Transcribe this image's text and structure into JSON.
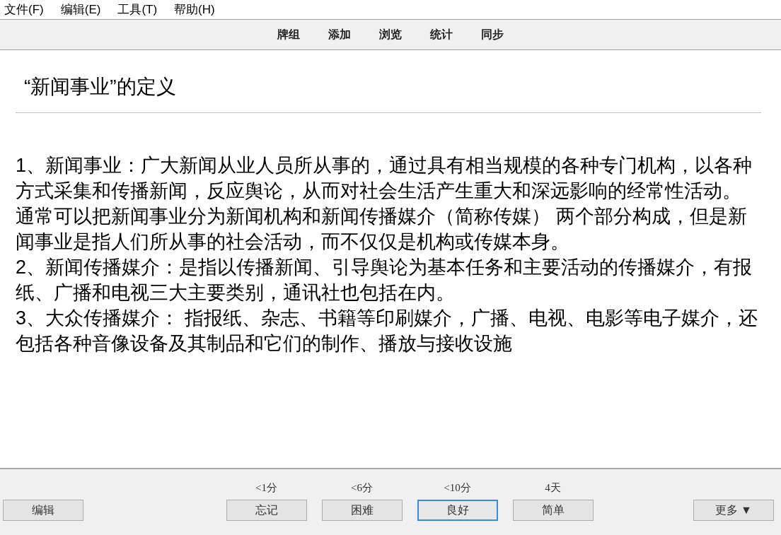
{
  "menu_bar": [
    "文件(F)",
    "编辑(E)",
    "工具(T)",
    "帮助(H)"
  ],
  "toolbar": [
    "牌组",
    "添加",
    "浏览",
    "统计",
    "同步"
  ],
  "card": {
    "title": "“新闻事业”的定义",
    "paragraphs": [
      "1、新闻事业：广大新闻从业人员所从事的，通过具有相当规模的各种专门机构，以各种方式采集和传播新闻，反应舆论，从而对社会生活产生重大和深远影响的经常性活动。通常可以把新闻事业分为新闻机构和新闻传播媒介（简称传媒） 两个部分构成，但是新闻事业是指人们所从事的社会活动，而不仅仅是机构或传媒本身。",
      "2、新闻传播媒介：是指以传播新闻、引导舆论为基本任务和主要活动的传播媒介，有报纸、广播和电视三大主要类别，通讯社也包括在内。",
      "3、大众传播媒介： 指报纸、杂志、书籍等印刷媒介，广播、电视、电影等电子媒介，还包括各种音像设备及其制品和它们的制作、播放与接收设施"
    ]
  },
  "bottom_bar": {
    "edit_button": "编辑",
    "answers": [
      {
        "interval": "<1分",
        "label": "忘记",
        "selected": false
      },
      {
        "interval": "<6分",
        "label": "困难",
        "selected": false
      },
      {
        "interval": "<10分",
        "label": "良好",
        "selected": true
      },
      {
        "interval": "4天",
        "label": "简单",
        "selected": false
      }
    ],
    "more_button": "更多 ▼"
  }
}
